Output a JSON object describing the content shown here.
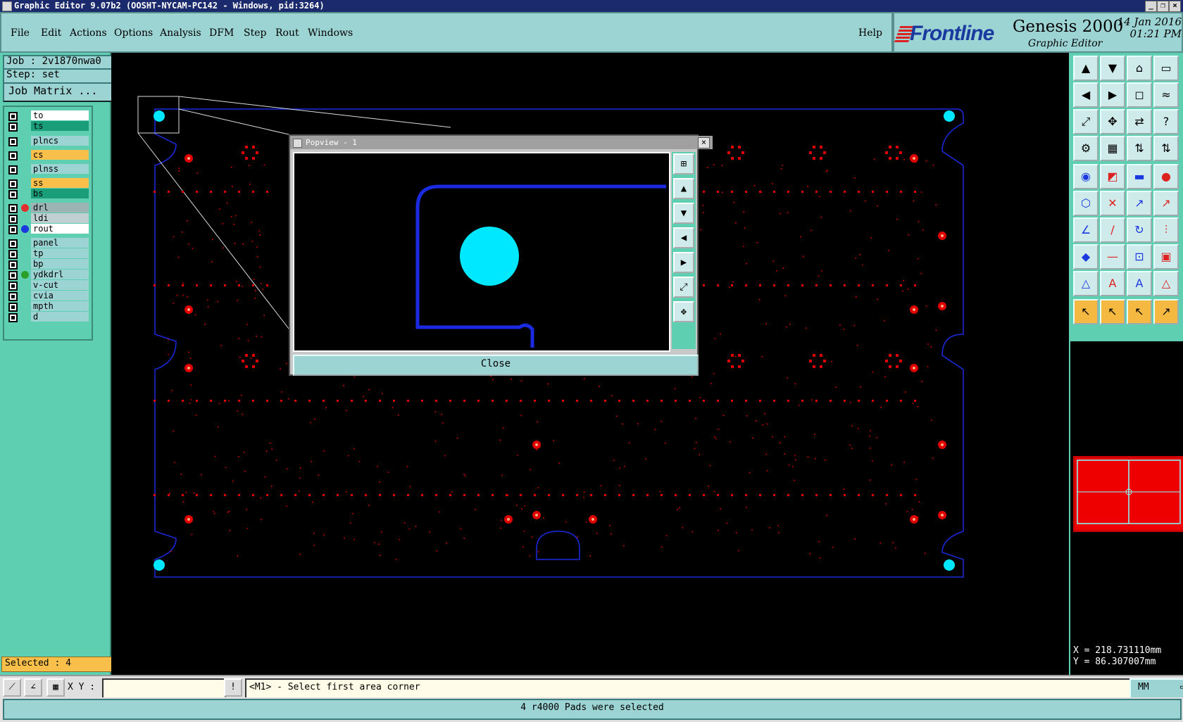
{
  "window": {
    "title": "Graphic Editor 9.07b2 (OOSHT-NYCAM-PC142 - Windows, pid:3264)"
  },
  "menu": [
    "File",
    "Edit",
    "Actions",
    "Options",
    "Analysis",
    "DFM",
    "Step",
    "Rout",
    "Windows"
  ],
  "help_label": "Help",
  "brand": {
    "logo": "Frontline",
    "product": "Genesis 2000",
    "subtitle": "Graphic Editor",
    "date": "14 Jan 2016",
    "time": "01:21 PM"
  },
  "job": {
    "job_label": "Job : 2v1870nwa0",
    "step_label": "Step: set",
    "matrix_button": "Job Matrix ..."
  },
  "layers": [
    {
      "name": "to",
      "color": "#ffffff",
      "mark": ""
    },
    {
      "name": "ts",
      "color": "#1a9e7a",
      "mark": ""
    },
    {
      "name": "plncs",
      "color": "#9cd3d3",
      "mark": ""
    },
    {
      "name": "cs",
      "color": "#f8c04a",
      "mark": ""
    },
    {
      "name": "plnss",
      "color": "#9cd3d3",
      "mark": ""
    },
    {
      "name": "ss",
      "color": "#f8c04a",
      "mark": ""
    },
    {
      "name": "bs",
      "color": "#1a9e7a",
      "mark": ""
    },
    {
      "name": "drl",
      "color": "#9cb4b4",
      "mark": "#e03030"
    },
    {
      "name": "ldi",
      "color": "#c0d0d0",
      "mark": ""
    },
    {
      "name": "rout",
      "color": "#ffffff",
      "mark": "#1a3ae0"
    },
    {
      "name": "panel",
      "color": "#9cd3d3",
      "mark": ""
    },
    {
      "name": "tp",
      "color": "#9cd3d3",
      "mark": ""
    },
    {
      "name": "bp",
      "color": "#9cd3d3",
      "mark": ""
    },
    {
      "name": "ydkdrl",
      "color": "#9cd3d3",
      "mark": "#2aa02a"
    },
    {
      "name": "v-cut",
      "color": "#9cd3d3",
      "mark": ""
    },
    {
      "name": "cvia",
      "color": "#9cd3d3",
      "mark": ""
    },
    {
      "name": "mpth",
      "color": "#9cd3d3",
      "mark": ""
    },
    {
      "name": "d",
      "color": "#9cd3d3",
      "mark": ""
    }
  ],
  "selected_label": "Selected : 4",
  "coords": {
    "x": "X = 218.731110mm",
    "y": "Y = 86.307007mm"
  },
  "cmd": {
    "xy_label": "X Y :",
    "xy_value": "",
    "prompt": "<M1> - Select first area corner",
    "units": "MM"
  },
  "status": "4 r4000 Pads were selected",
  "popview": {
    "title": "Popview - 1",
    "close_label": "Close"
  },
  "colors": {
    "pad_red": "#e00000",
    "rout_blue": "#1a2ae0",
    "cyan": "#00e8ff",
    "panel_bg": "#5ecfb0"
  }
}
